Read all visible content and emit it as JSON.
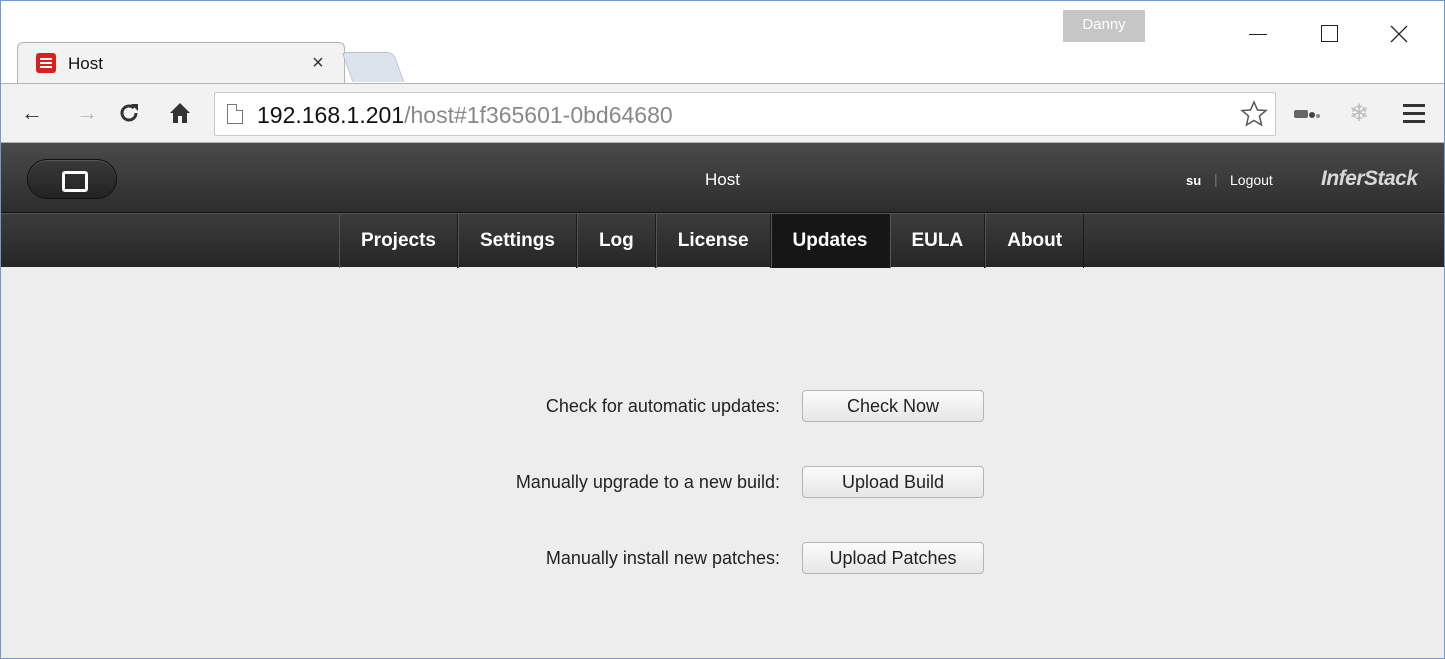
{
  "window": {
    "user_badge": "Danny"
  },
  "tab": {
    "title": "Host",
    "close_glyph": "×"
  },
  "address_bar": {
    "url_host": "192.168.1.201",
    "url_path": "/host#1f365601-0bd64680"
  },
  "app": {
    "title": "Host",
    "user": "su",
    "separator": "|",
    "logout_label": "Logout",
    "brand": "InferStack"
  },
  "nav": {
    "items": [
      {
        "label": "Projects",
        "active": false
      },
      {
        "label": "Settings",
        "active": false
      },
      {
        "label": "Log",
        "active": false
      },
      {
        "label": "License",
        "active": false
      },
      {
        "label": "Updates",
        "active": true
      },
      {
        "label": "EULA",
        "active": false
      },
      {
        "label": "About",
        "active": false
      }
    ]
  },
  "updates": {
    "check_label": "Check for automatic updates:",
    "check_button": "Check Now",
    "build_label": "Manually upgrade to a new build:",
    "build_button": "Upload Build",
    "patches_label": "Manually install new patches:",
    "patches_button": "Upload Patches"
  },
  "icons": {
    "back": "arrow-left-icon",
    "forward": "arrow-right-icon",
    "reload": "reload-icon",
    "home": "home-icon",
    "bookmark": "star-icon",
    "menu": "hamburger-icon"
  }
}
